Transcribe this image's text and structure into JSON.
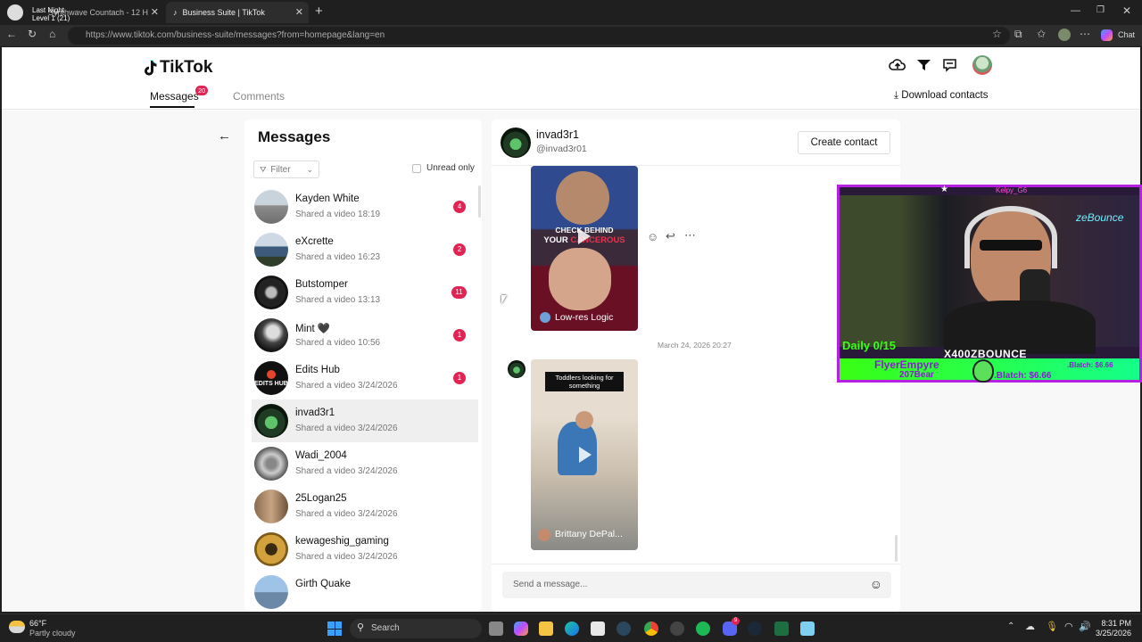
{
  "browser": {
    "tabs": [
      {
        "label": "Synthwave Countach - 12 H"
      },
      {
        "label": "Business Suite | TikTok"
      }
    ],
    "overlay_tab_text": {
      "line1": "Last Night",
      "line2": "Level 1 (21)"
    },
    "new_tab_glyph": "+",
    "url": "https://www.tiktok.com/business-suite/messages?from=homepage&lang=en",
    "chat_label": "Chat"
  },
  "header": {
    "logo_text": "TikTok",
    "tabs": [
      {
        "label": "Messages",
        "badge": "20"
      },
      {
        "label": "Comments"
      }
    ],
    "download_label": "Download contacts"
  },
  "messages_panel": {
    "title": "Messages",
    "filter_label": "Filter",
    "unread_label": "Unread only",
    "conversations": [
      {
        "name": "Kayden White",
        "sub": "Shared a video 18:19",
        "badge": "4"
      },
      {
        "name": "eXcrette",
        "sub": "Shared a video 16:23",
        "badge": "2"
      },
      {
        "name": "Butstomper",
        "sub": "Shared a video 13:13",
        "badge": "11"
      },
      {
        "name": "Mint 🖤",
        "sub": "Shared a video 10:56",
        "badge": "1"
      },
      {
        "name": "Edits Hub",
        "sub": "Shared a video 3/24/2026",
        "badge": "1"
      },
      {
        "name": "invad3r1",
        "sub": "Shared a video 3/24/2026",
        "badge": ""
      },
      {
        "name": "Wadi_2004",
        "sub": "Shared a video 3/24/2026",
        "badge": ""
      },
      {
        "name": "25Logan25",
        "sub": "Shared a video 3/24/2026",
        "badge": ""
      },
      {
        "name": "kewageshig_gaming",
        "sub": "Shared a video 3/24/2026",
        "badge": ""
      },
      {
        "name": "Girth Quake",
        "sub": "",
        "badge": ""
      }
    ],
    "edits_hub_avatar_text": "EDITS HUB"
  },
  "chat": {
    "name": "invad3r1",
    "handle": "@invad3r01",
    "create_contact": "Create contact",
    "video1": {
      "overlay1": "CHECK BEHIND",
      "overlay2a": "YOUR ",
      "overlay2b": "CANCEROUS",
      "author": "Low-res Logic"
    },
    "timestamp": "March 24, 2026 20:27",
    "video2": {
      "caption": "Toddlers looking for something",
      "author": "Brittany DePal..."
    },
    "input_placeholder": "Send a message..."
  },
  "webcam": {
    "top_label": "Kelpy_G6",
    "daily": "Daily 0/15",
    "streamer": "X400ZBOUNCE",
    "ticker1": "FlyerEmpyre",
    "ticker2": "207Bear",
    "blatch1": ".Blatch: $6.66",
    "blatch2": ".Blatch: $6.66",
    "sign": "zeBounce"
  },
  "taskbar": {
    "weather_temp": "66°F",
    "weather_desc": "Partly cloudy",
    "search_label": "Search",
    "time": "8:31 PM",
    "date": "3/25/2026",
    "discord_badge": "9"
  },
  "colors": {
    "accent": "#e02454",
    "badge_red": "#e02454",
    "neon_green": "#39ff14",
    "neon_purple": "#b620e0"
  }
}
